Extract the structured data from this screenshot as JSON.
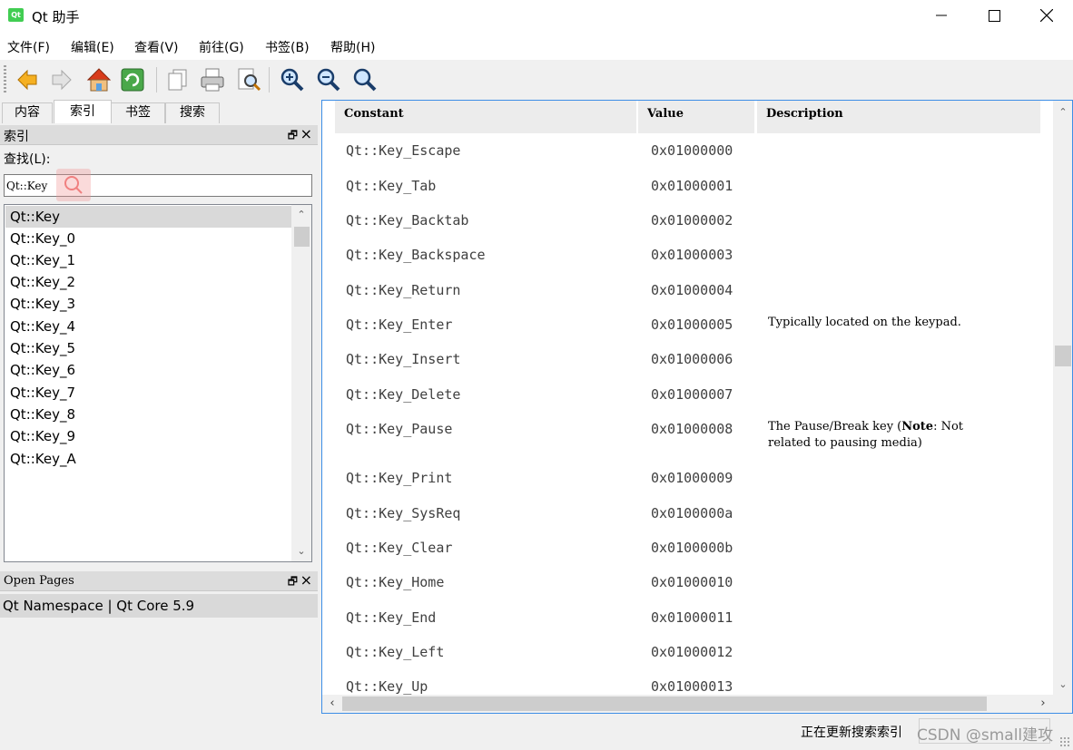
{
  "window": {
    "title": "Qt 助手",
    "icon_text": "Qt"
  },
  "menu": [
    "文件(F)",
    "编辑(E)",
    "查看(V)",
    "前往(G)",
    "书签(B)",
    "帮助(H)"
  ],
  "toolbar": [
    "back-icon",
    "forward-icon",
    "home-icon",
    "sync-icon",
    "copy-icon",
    "print-icon",
    "find-icon",
    "zoom-in-icon",
    "zoom-out-icon",
    "zoom-reset-icon"
  ],
  "tabs": [
    "内容",
    "索引",
    "书签",
    "搜索"
  ],
  "index_panel": {
    "title": "索引",
    "search_label": "查找(L):",
    "search_value": "Qt::Key",
    "items": [
      "Qt::Key",
      "Qt::Key_0",
      "Qt::Key_1",
      "Qt::Key_2",
      "Qt::Key_3",
      "Qt::Key_4",
      "Qt::Key_5",
      "Qt::Key_6",
      "Qt::Key_7",
      "Qt::Key_8",
      "Qt::Key_9",
      "Qt::Key_A"
    ]
  },
  "open_pages": {
    "title": "Open Pages",
    "items": [
      "Qt Namespace | Qt Core 5.9"
    ]
  },
  "table": {
    "headers": [
      "Constant",
      "Value",
      "Description"
    ],
    "rows": [
      {
        "constant": "Qt::Key_Escape",
        "value": "0x01000000",
        "description": ""
      },
      {
        "constant": "Qt::Key_Tab",
        "value": "0x01000001",
        "description": ""
      },
      {
        "constant": "Qt::Key_Backtab",
        "value": "0x01000002",
        "description": ""
      },
      {
        "constant": "Qt::Key_Backspace",
        "value": "0x01000003",
        "description": ""
      },
      {
        "constant": "Qt::Key_Return",
        "value": "0x01000004",
        "description": ""
      },
      {
        "constant": "Qt::Key_Enter",
        "value": "0x01000005",
        "description": "Typically located on the keypad."
      },
      {
        "constant": "Qt::Key_Insert",
        "value": "0x01000006",
        "description": ""
      },
      {
        "constant": "Qt::Key_Delete",
        "value": "0x01000007",
        "description": ""
      },
      {
        "constant": "Qt::Key_Pause",
        "value": "0x01000008",
        "description": "The Pause/Break key (Note: Not related to pausing media)",
        "note_word": "Note"
      },
      {
        "constant": "Qt::Key_Print",
        "value": "0x01000009",
        "description": ""
      },
      {
        "constant": "Qt::Key_SysReq",
        "value": "0x0100000a",
        "description": ""
      },
      {
        "constant": "Qt::Key_Clear",
        "value": "0x0100000b",
        "description": ""
      },
      {
        "constant": "Qt::Key_Home",
        "value": "0x01000010",
        "description": ""
      },
      {
        "constant": "Qt::Key_End",
        "value": "0x01000011",
        "description": ""
      },
      {
        "constant": "Qt::Key_Left",
        "value": "0x01000012",
        "description": ""
      },
      {
        "constant": "Qt::Key_Up",
        "value": "0x01000013",
        "description": ""
      }
    ]
  },
  "status": {
    "text": "正在更新搜索索引",
    "watermark": "CSDN @small建攻"
  }
}
